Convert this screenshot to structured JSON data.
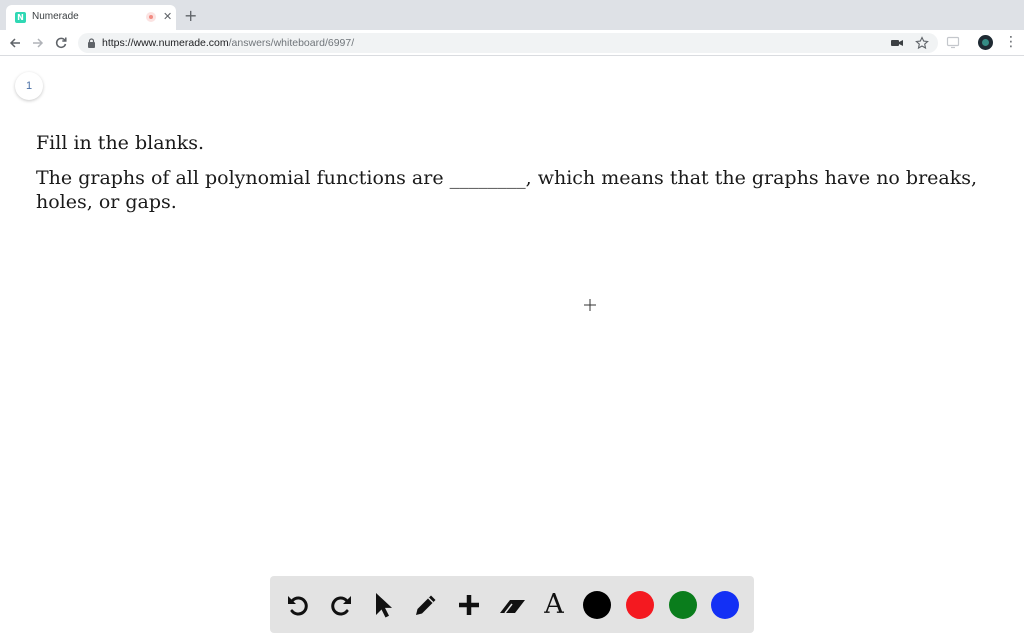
{
  "browser": {
    "tab": {
      "title": "Numerade",
      "favicon_letter": "N"
    },
    "new_tab_label": "+",
    "url": {
      "host": "https://www.numerade.com",
      "path": "/answers/whiteboard/6997/"
    },
    "menu_label": "⋮"
  },
  "page": {
    "page_number": "1",
    "question": {
      "prompt": "Fill in the blanks.",
      "body": "The graphs of all polynomial functions are ________, which means that the graphs have no breaks, holes, or gaps."
    }
  },
  "drawing_toolbar": {
    "tools": [
      "undo-icon",
      "redo-icon",
      "select-cursor-icon",
      "pencil-icon",
      "add-icon",
      "eraser-icon",
      "text-tool-icon"
    ],
    "text_tool_label": "A",
    "colors": [
      "#000000",
      "#f41920",
      "#0a7d1c",
      "#1330f5"
    ]
  }
}
